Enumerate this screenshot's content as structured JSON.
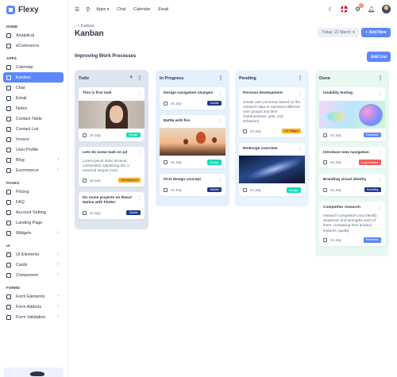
{
  "brand": {
    "name": "Flexy"
  },
  "topbar": {
    "apps_label": "Apps",
    "links": [
      "Chat",
      "Calendar",
      "Email"
    ],
    "notifications_count": "3"
  },
  "sidebar": {
    "sections": [
      {
        "title": "HOME",
        "items": [
          {
            "label": "Analytical",
            "icon": "aperture-icon",
            "chevron": false,
            "active": false
          },
          {
            "label": "eCommerce",
            "icon": "shopping-cart-icon",
            "chevron": false,
            "active": false
          }
        ]
      },
      {
        "title": "APPS",
        "items": [
          {
            "label": "Calendar",
            "icon": "calendar-icon",
            "chevron": false,
            "active": false
          },
          {
            "label": "Kanban",
            "icon": "kanban-icon",
            "chevron": false,
            "active": true
          },
          {
            "label": "Chat",
            "icon": "chat-icon",
            "chevron": false,
            "active": false
          },
          {
            "label": "Email",
            "icon": "mail-icon",
            "chevron": false,
            "active": false
          },
          {
            "label": "Notes",
            "icon": "notes-icon",
            "chevron": false,
            "active": false
          },
          {
            "label": "Contact Table",
            "icon": "phone-icon",
            "chevron": false,
            "active": false
          },
          {
            "label": "Contact List",
            "icon": "list-icon",
            "chevron": false,
            "active": false
          },
          {
            "label": "Invoice",
            "icon": "file-text-icon",
            "chevron": false,
            "active": false
          },
          {
            "label": "User Profile",
            "icon": "user-circle-icon",
            "chevron": false,
            "active": false
          },
          {
            "label": "Blog",
            "icon": "chart-donut-icon",
            "chevron": true,
            "active": false
          },
          {
            "label": "Ecommerce",
            "icon": "basket-icon",
            "chevron": true,
            "active": false
          }
        ]
      },
      {
        "title": "PAGES",
        "items": [
          {
            "label": "Pricing",
            "icon": "currency-icon",
            "chevron": false,
            "active": false
          },
          {
            "label": "FAQ",
            "icon": "help-icon",
            "chevron": false,
            "active": false
          },
          {
            "label": "Account Setting",
            "icon": "user-settings-icon",
            "chevron": false,
            "active": false
          },
          {
            "label": "Landing Page",
            "icon": "app-window-icon",
            "chevron": false,
            "active": false
          },
          {
            "label": "Widgets",
            "icon": "layout-icon",
            "chevron": true,
            "active": false
          }
        ]
      },
      {
        "title": "UI",
        "items": [
          {
            "label": "UI Elements",
            "icon": "layout-grid-icon",
            "chevron": true,
            "active": false
          },
          {
            "label": "Cards",
            "icon": "cards-icon",
            "chevron": true,
            "active": false
          },
          {
            "label": "Component",
            "icon": "components-icon",
            "chevron": true,
            "active": false
          }
        ]
      },
      {
        "title": "FORMS",
        "items": [
          {
            "label": "Form Elements",
            "icon": "forms-icon",
            "chevron": true,
            "active": false
          },
          {
            "label": "Form Addons",
            "icon": "forms-add-icon",
            "chevron": true,
            "active": false
          },
          {
            "label": "Form Validation",
            "icon": "validation-icon",
            "chevron": true,
            "active": false
          }
        ]
      }
    ]
  },
  "page": {
    "breadcrumb_current": "Kanban",
    "title": "Kanban",
    "date_filter": "Today: 22 March",
    "add_new": "+ Add New",
    "board_title": "Improving Work Processes",
    "add_list": "Add List"
  },
  "columns": [
    {
      "title": "Todo",
      "bg": "#dfe5ef",
      "show_add": true,
      "cards": [
        {
          "title": "This is first task",
          "image": "portrait",
          "date": "24 July",
          "tag": "Design",
          "tag_class": "design"
        },
        {
          "title": "Lets do some task on pd",
          "body": "Lorem ipsum dolor sit amet, consectetur adipisicing elit, o eiusmod tempor incid.",
          "date": "24 July",
          "tag": "Development",
          "tag_class": "dev"
        },
        {
          "title": "Do some projects on React Native with Flutter",
          "date": "24 July",
          "tag": "Mobile",
          "tag_class": "mobile"
        }
      ]
    },
    {
      "title": "In Progress",
      "bg": "#e5f0fd",
      "show_add": false,
      "cards": [
        {
          "title": "Design navigation changes",
          "date": "24 July",
          "tag": "Mobile",
          "tag_class": "mobile"
        },
        {
          "title": "Battle with fire",
          "image": "balloon",
          "date": "24 July",
          "tag": "Design",
          "tag_class": "design"
        },
        {
          "title": "First design concept",
          "date": "24 July",
          "tag": "Mobile",
          "tag_class": "mobile"
        }
      ]
    },
    {
      "title": "Pending",
      "bg": "#e9f3fd",
      "show_add": false,
      "cards": [
        {
          "title": "Persona development",
          "body": "Create user personas based on the research data to represent different user groups and their characteristics, gols, and behaviors.",
          "date": "24 July",
          "tag": "UX Stages",
          "tag_class": "ux"
        },
        {
          "title": "Redesign overview",
          "image": "space",
          "date": "24 July",
          "tag": "Design",
          "tag_class": "design"
        }
      ]
    },
    {
      "title": "Done",
      "bg": "#e7f8f1",
      "show_add": false,
      "cards": [
        {
          "title": "Usability testing",
          "image": "abstract",
          "date": "24 July",
          "tag": "Research",
          "tag_class": "research"
        },
        {
          "title": "Introduce new navigation",
          "date": "24 July",
          "tag": "Data Science",
          "tag_class": "datascience"
        },
        {
          "title": "Branding visual identity",
          "date": "24 July",
          "tag": "Branding",
          "tag_class": "branding"
        },
        {
          "title": "Competitor research",
          "body": "research competitors and identify weakness and strengths each of them, comparing their product features, quality.",
          "date": "24 July",
          "tag": "Research",
          "tag_class": "research"
        }
      ]
    }
  ]
}
